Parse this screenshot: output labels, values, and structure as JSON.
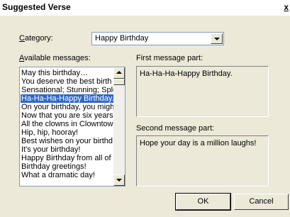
{
  "window": {
    "title": "Suggested Verse",
    "close_label": "x"
  },
  "category": {
    "label_prefix": "C",
    "label_rest": "ategory:",
    "value": "Happy Birthday"
  },
  "available": {
    "label_prefix": "A",
    "label_rest": "vailable messages:",
    "items": [
      "May this birthday…",
      "You deserve the best birth",
      "Sensational; Stunning; Sple",
      "Ha-Ha-Ha-Happy Birthday.",
      "On your birthday, you migh",
      "Now that you are six years",
      "All the clowns in Clowntowr",
      "Hip, hip, hooray!",
      "Best wishes on your birthd",
      "It's your birthday!",
      "Happy Birthday from all of",
      "Birthday greetings!",
      "What a dramatic day!"
    ],
    "selected_item": "Ha-Ha-Ha-Happy Birthday."
  },
  "first_part": {
    "label": "First message part:",
    "text": "Ha-Ha-Ha-Happy Birthday."
  },
  "second_part": {
    "label": "Second message part:",
    "text": "Hope your day is a million laughs!"
  },
  "buttons": {
    "ok": "OK",
    "cancel": "Cancel"
  }
}
